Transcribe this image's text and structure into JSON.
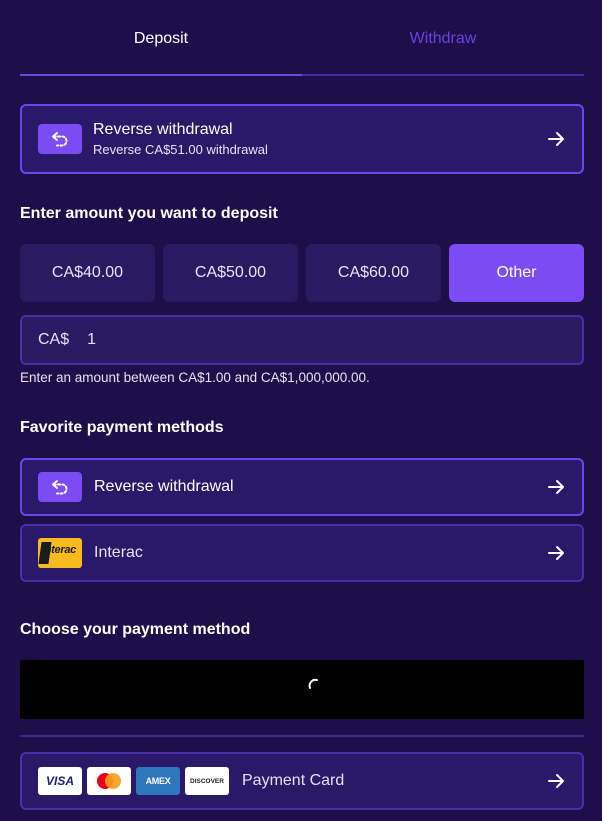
{
  "tabs": [
    {
      "label": "Deposit",
      "active": true
    },
    {
      "label": "Withdraw",
      "active": false
    }
  ],
  "reverse_card": {
    "title": "Reverse withdrawal",
    "subtitle": "Reverse CA$51.00 withdrawal",
    "icon": "undo-icon"
  },
  "amount_section": {
    "title": "Enter amount you want to deposit",
    "options": [
      "CA$40.00",
      "CA$50.00",
      "CA$60.00",
      "Other"
    ],
    "selected": "Other",
    "currency": "CA$",
    "value": "1",
    "hint": "Enter an amount between CA$1.00 and CA$1,000,000.00."
  },
  "favorites": {
    "title": "Favorite payment methods",
    "items": [
      {
        "label": "Reverse withdrawal",
        "icon": "undo-icon"
      },
      {
        "label": "Interac",
        "icon": "interac-logo",
        "logo_text": "Interac"
      }
    ]
  },
  "choose": {
    "title": "Choose your payment method",
    "payment_card": {
      "label": "Payment Card",
      "logos": [
        "VISA",
        "Mastercard",
        "AMEX",
        "DISCOVER"
      ]
    }
  },
  "colors": {
    "background": "#1e0f4a",
    "accent": "#7b4cf3",
    "card": "#2a1968",
    "border": "#6a45ea"
  }
}
